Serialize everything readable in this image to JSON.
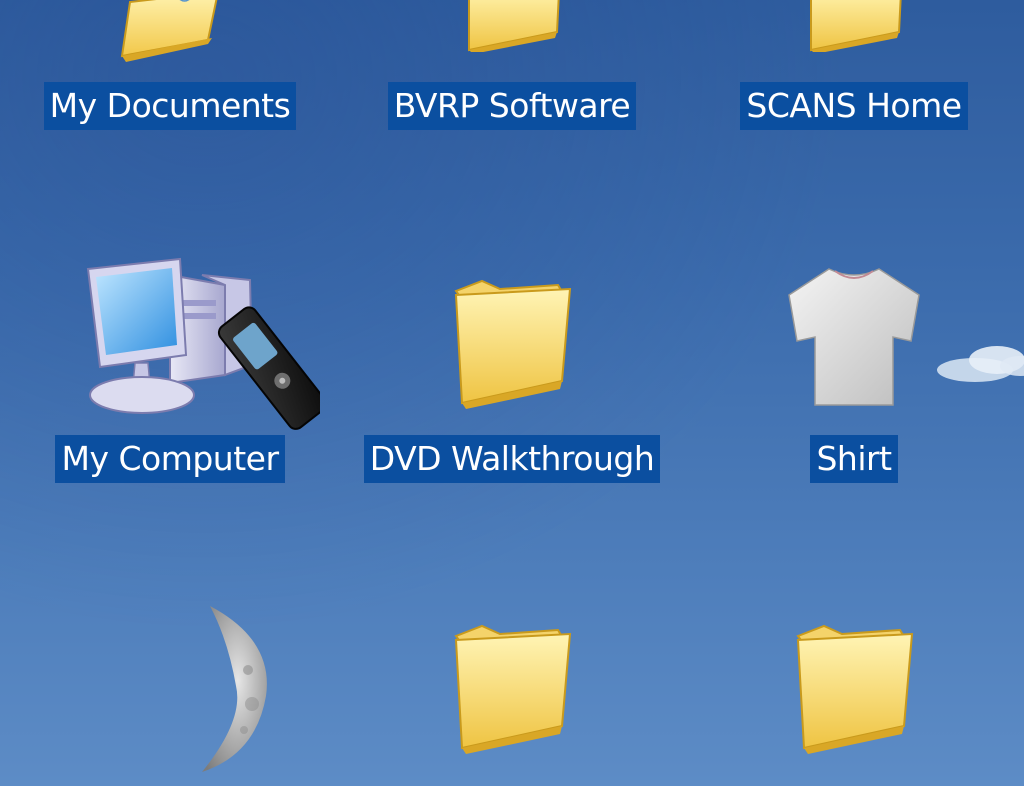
{
  "desktop": {
    "background_color": "#3b6bac",
    "label_highlight_color": "#0b4fa0",
    "icons": [
      {
        "label": "My Documents",
        "icon": "my-documents-icon"
      },
      {
        "label": "BVRP Software",
        "icon": "folder-icon"
      },
      {
        "label": "SCANS Home",
        "icon": "folder-icon"
      },
      {
        "label": "My Computer",
        "icon": "my-computer-icon"
      },
      {
        "label": "DVD Walkthrough",
        "icon": "folder-icon"
      },
      {
        "label": "Shirt",
        "icon": "shirt-icon"
      },
      {
        "label": "",
        "icon": "moon-icon"
      },
      {
        "label": "",
        "icon": "folder-icon"
      },
      {
        "label": "",
        "icon": "folder-icon"
      }
    ]
  }
}
